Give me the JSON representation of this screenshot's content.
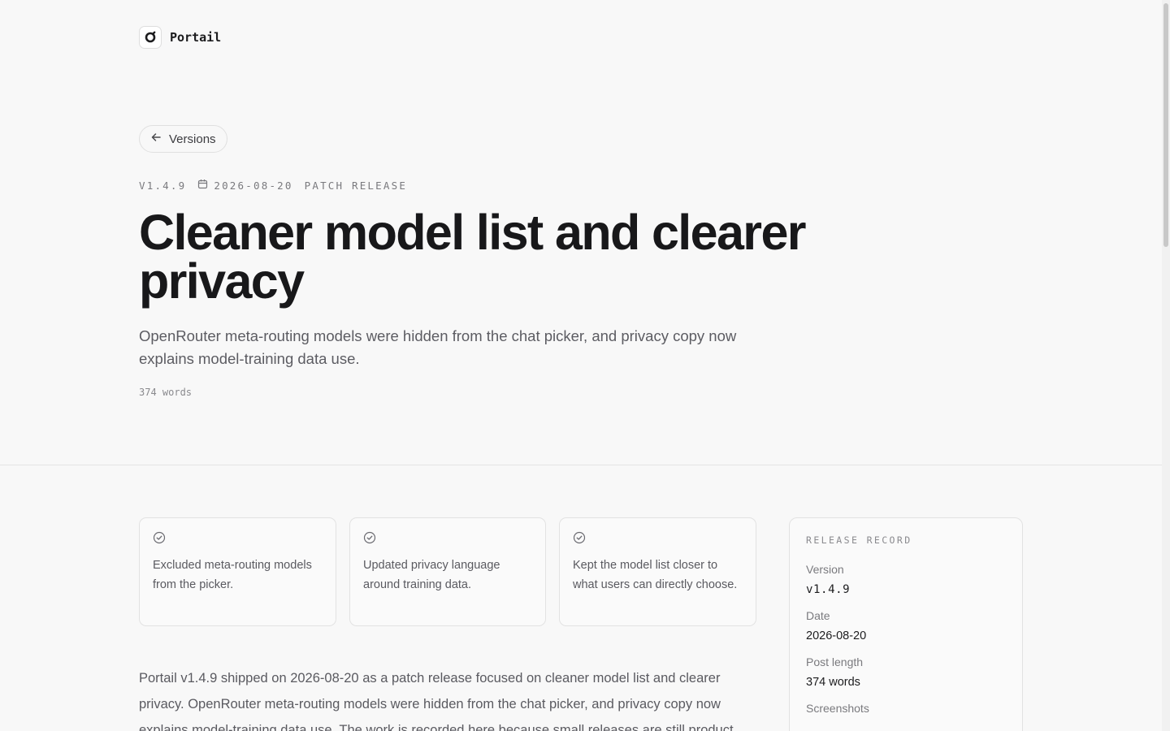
{
  "brand": {
    "name": "Portail",
    "icon": "portail-logo-icon"
  },
  "nav": {
    "back_label": "Versions",
    "back_icon": "arrow-left-icon"
  },
  "meta": {
    "version": "V1.4.9",
    "date": "2026-08-20",
    "date_icon": "calendar-icon",
    "release_type": "PATCH RELEASE"
  },
  "hero": {
    "title": "Cleaner model list and clearer privacy",
    "subtitle": "OpenRouter meta-routing models were hidden from the chat picker, and privacy copy now explains model-training data use.",
    "word_count": "374 words"
  },
  "highlights": [
    {
      "icon": "check-circle-icon",
      "text": "Excluded meta-routing models from the picker."
    },
    {
      "icon": "check-circle-icon",
      "text": "Updated privacy language around training data."
    },
    {
      "icon": "check-circle-icon",
      "text": "Kept the model list closer to what users can directly choose."
    }
  ],
  "body": {
    "paragraph": "Portail v1.4.9 shipped on 2026-08-20 as a patch release focused on cleaner model list and clearer privacy. OpenRouter meta-routing models were hidden from the chat picker, and privacy copy now explains model-training data use. The work is recorded here because small releases are still product"
  },
  "record": {
    "heading": "RELEASE RECORD",
    "rows": [
      {
        "label": "Version",
        "value": "v1.4.9"
      },
      {
        "label": "Date",
        "value": "2026-08-20"
      },
      {
        "label": "Post length",
        "value": "374 words"
      },
      {
        "label": "Screenshots",
        "value": ""
      }
    ]
  },
  "colors": {
    "background": "#f8f8f8",
    "text_primary": "#1c1c1e",
    "text_muted": "#5a5a60",
    "border": "#e2e2e2"
  }
}
